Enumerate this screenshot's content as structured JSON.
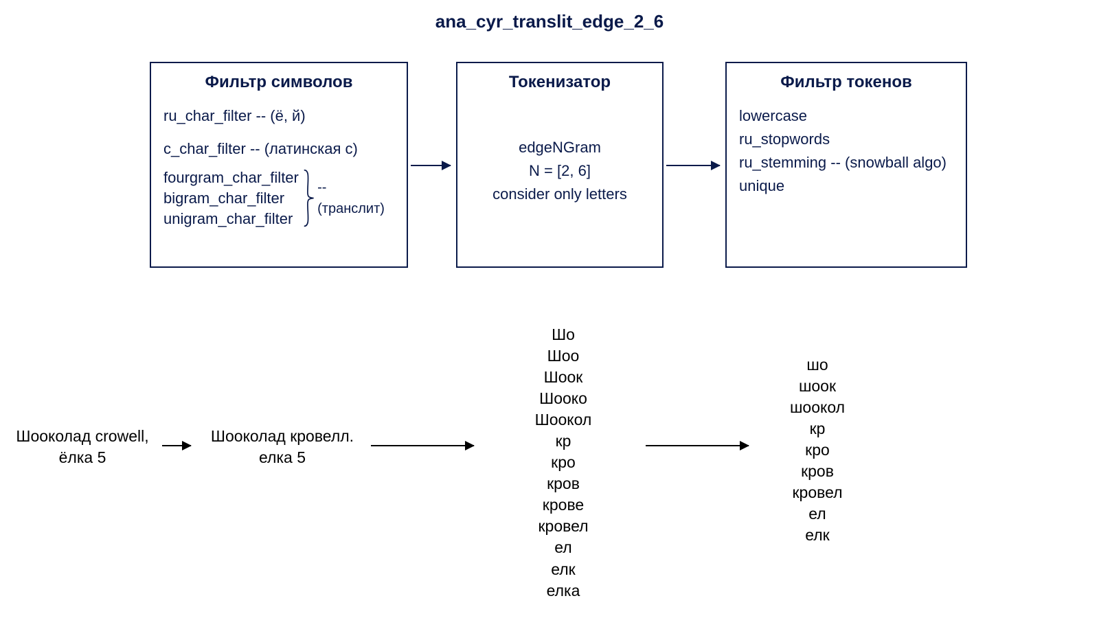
{
  "title": "ana_cyr_translit_edge_2_6",
  "boxes": {
    "charFilter": {
      "title": "Фильтр символов",
      "line1": "ru_char_filter -- (ё, й)",
      "line2": "c_char_filter -- (латинская с)",
      "gramList": {
        "a": "fourgram_char_filter",
        "b": "bigram_char_filter",
        "c": "unigram_char_filter"
      },
      "gramNote": "-- (транслит)"
    },
    "tokenizer": {
      "title": "Токенизатор",
      "line1": "edgeNGram",
      "line2": "N = [2, 6]",
      "line3": "consider only letters"
    },
    "tokenFilter": {
      "title": "Фильтр токенов",
      "line1": "lowercase",
      "line2": "ru_stopwords",
      "line3": "ru_stemming -- (snowball algo)",
      "line4": "unique"
    }
  },
  "example": {
    "input": "Шооколад crowell,\nёлка 5",
    "afterChar": "Шооколад кровелл.\nелка 5",
    "afterTokenizer": "Шо\nШоо\nШоок\nШооко\nШоокол\nкр\nкро\nкров\nкрове\nкровел\nел\nелк\nелка",
    "afterTokenFilter": "шо\nшоок\nшоокол\nкр\nкро\nкров\nкровел\nел\nелк"
  }
}
